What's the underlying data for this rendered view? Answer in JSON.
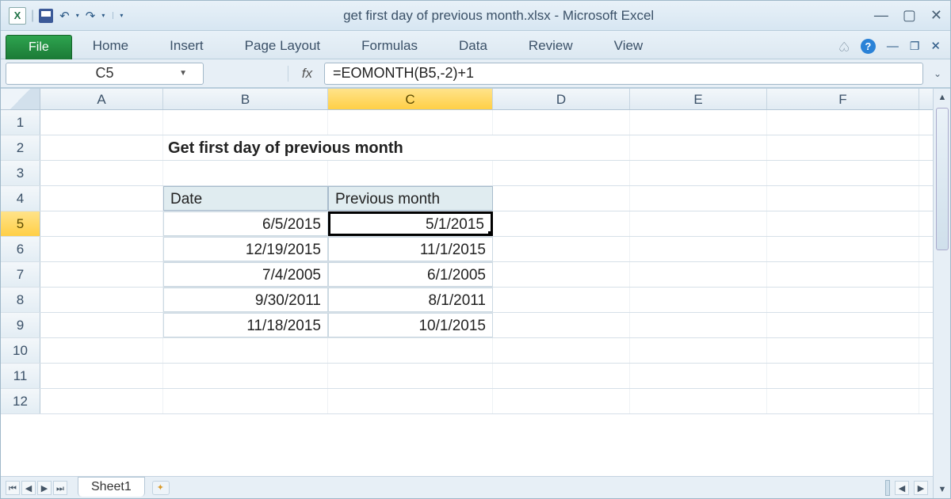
{
  "window": {
    "title_doc": "get first day of previous month.xlsx",
    "title_app": "Microsoft Excel"
  },
  "qat": {
    "excel": "X"
  },
  "ribbon": {
    "file": "File",
    "tabs": [
      "Home",
      "Insert",
      "Page Layout",
      "Formulas",
      "Data",
      "Review",
      "View"
    ]
  },
  "namebox": {
    "value": "C5"
  },
  "formula_bar": {
    "fx": "fx",
    "value": "=EOMONTH(B5,-2)+1"
  },
  "columns": [
    "A",
    "B",
    "C",
    "D",
    "E",
    "F"
  ],
  "row_count": 12,
  "active_cell": {
    "row": 5,
    "col": "C"
  },
  "content": {
    "title": "Get first day of previous month",
    "headers": {
      "date": "Date",
      "prev": "Previous month"
    },
    "rows": [
      {
        "date": "6/5/2015",
        "prev": "5/1/2015"
      },
      {
        "date": "12/19/2015",
        "prev": "11/1/2015"
      },
      {
        "date": "7/4/2005",
        "prev": "6/1/2005"
      },
      {
        "date": "9/30/2011",
        "prev": "8/1/2011"
      },
      {
        "date": "11/18/2015",
        "prev": "10/1/2015"
      }
    ]
  },
  "sheets": {
    "active": "Sheet1"
  }
}
